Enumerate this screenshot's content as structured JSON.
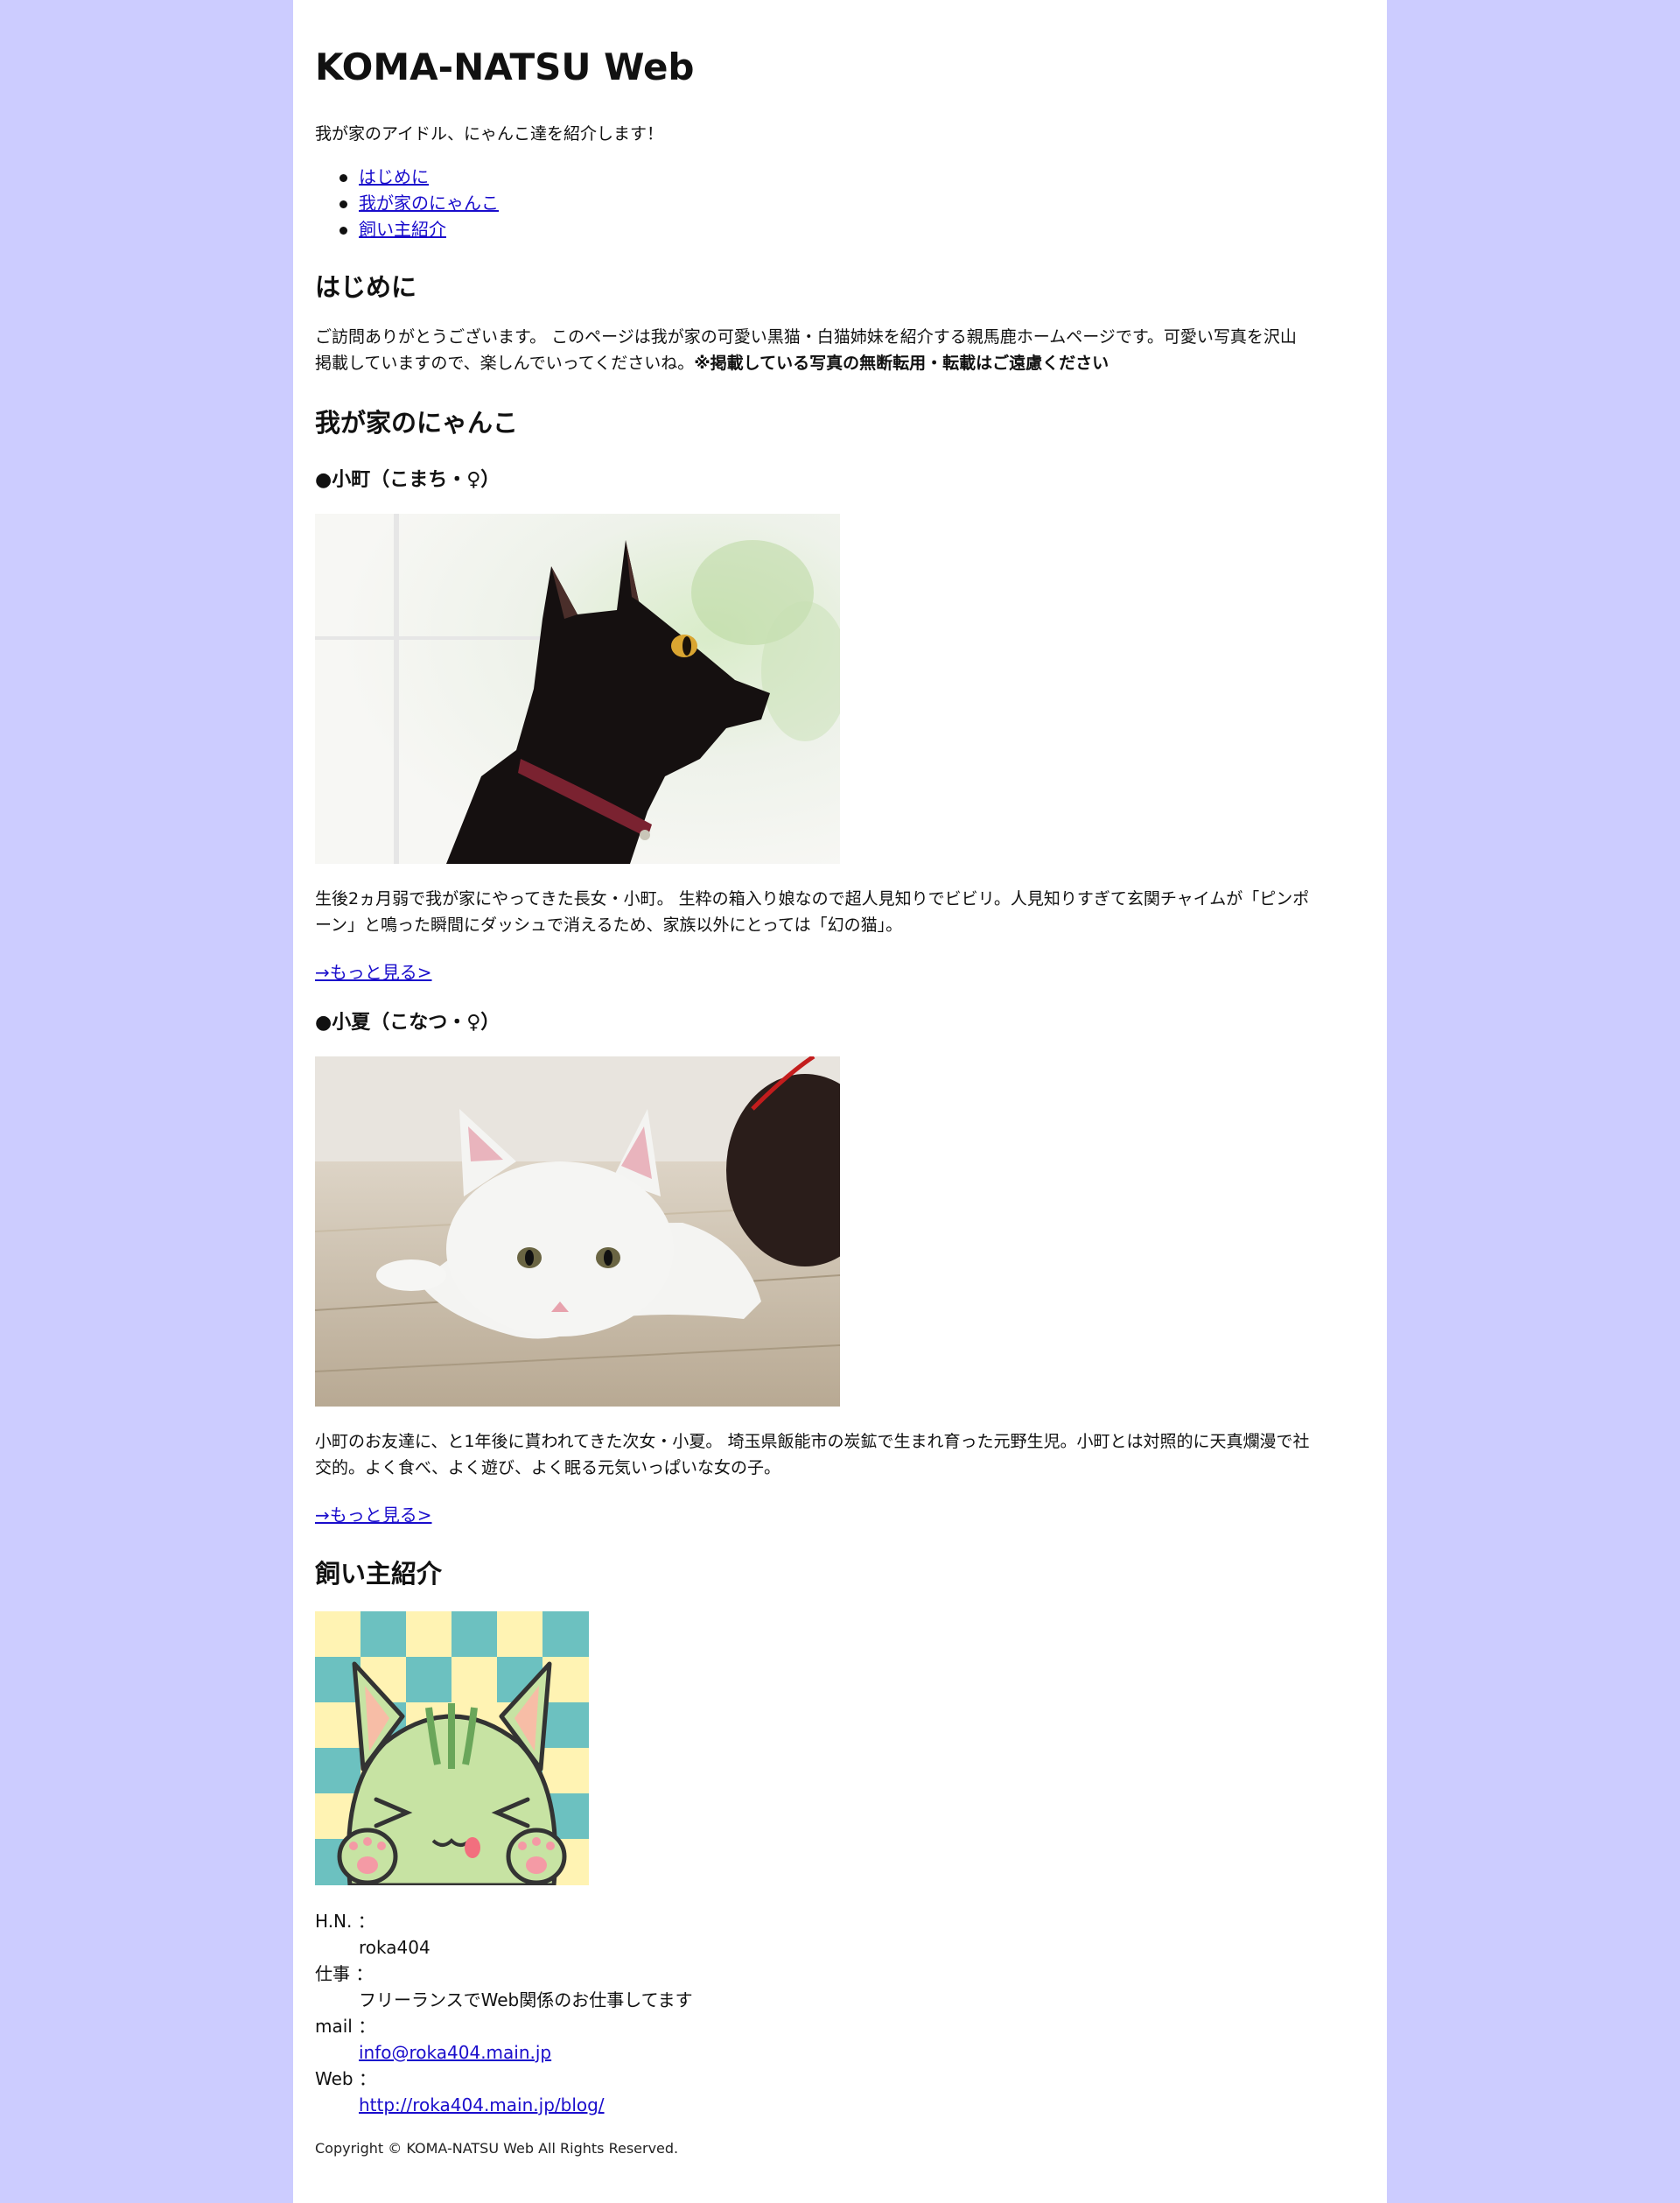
{
  "site": {
    "title": "KOMA-NATSU Web",
    "tagline": "我が家のアイドル、にゃんこ達を紹介します！"
  },
  "toc": {
    "items": [
      {
        "label": "はじめに"
      },
      {
        "label": "我が家のにゃんこ"
      },
      {
        "label": "飼い主紹介"
      }
    ]
  },
  "intro": {
    "heading": "はじめに",
    "text_line1": "ご訪問ありがとうございます。 このページは我が家の可愛い黒猫・白猫姉妹を紹介する親馬鹿ホームページです。可愛い写真を沢山",
    "text_line2": "掲載していますので、楽しんでいってくださいね。",
    "warning": "※掲載している写真の無断転用・転載はご遠慮ください"
  },
  "cats": {
    "heading": "我が家のにゃんこ",
    "komachi": {
      "name": "●小町（こまち・♀）",
      "text_line1": "生後2ヵ月弱で我が家にやってきた長女・小町。 生粋の箱入り娘なので超人見知りでビビリ。人見知りすぎて玄関チャイムが「ピンポ",
      "text_line2": "ーン」と鳴った瞬間にダッシュで消えるため、家族以外にとっては「幻の猫」。",
      "more": "→もっと見る>"
    },
    "konatsu": {
      "name": "●小夏（こなつ・♀）",
      "text_line1": "小町のお友達に、と1年後に貰われてきた次女・小夏。 埼玉県飯能市の炭鉱で生まれ育った元野生児。小町とは対照的に天真爛漫で社",
      "text_line2": "交的。よく食べ、よく遊び、よく眠る元気いっぱいな女の子。",
      "more": "→もっと見る>"
    }
  },
  "owner": {
    "heading": "飼い主紹介",
    "hn_label": "H.N. ：",
    "hn_value": "roka404",
    "job_label": "仕事 ：",
    "job_value": "フリーランスでWeb関係のお仕事してます",
    "mail_label": "mail ：",
    "mail_value": "info@roka404.main.jp",
    "web_label": "Web ：",
    "web_value": "http://roka404.main.jp/blog/"
  },
  "footer": {
    "copyright": "Copyright © KOMA-NATSU Web All Rights Reserved."
  },
  "colors": {
    "background": "#ccccff",
    "content": "#ffffff",
    "link": "#1a0dcc"
  }
}
